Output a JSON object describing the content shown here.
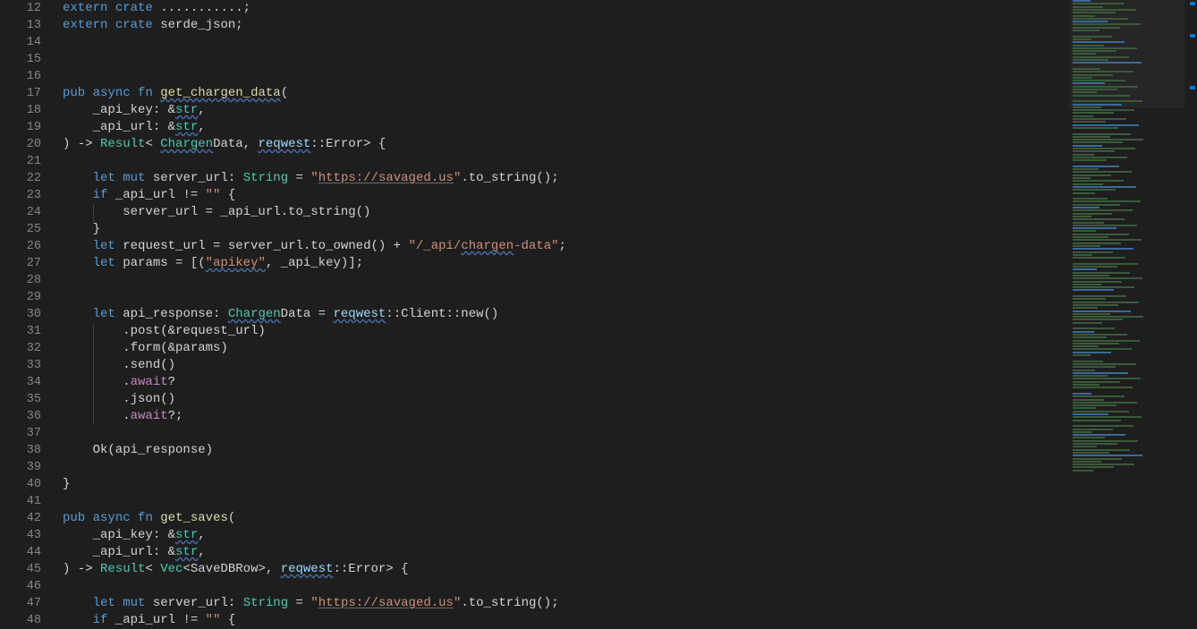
{
  "first_line_number": 12,
  "lines": [
    [
      [
        "kw",
        "extern"
      ],
      [
        "",
        ""
      ],
      [
        "kw",
        "crate"
      ],
      [
        "",
        ""
      ],
      [
        "",
        "...........;"
      ]
    ],
    [
      [
        "kw",
        "extern"
      ],
      [
        "",
        ""
      ],
      [
        "kw",
        "crate"
      ],
      [
        "",
        ""
      ],
      [
        "",
        "serde_json;"
      ]
    ],
    [],
    [],
    [],
    [
      [
        "kw",
        "pub"
      ],
      [
        "",
        ""
      ],
      [
        "kw",
        "async"
      ],
      [
        "",
        ""
      ],
      [
        "kw",
        "fn"
      ],
      [
        "",
        ""
      ],
      [
        "fn squiggly",
        "get_chargen_data"
      ],
      [
        "",
        "("
      ]
    ],
    [
      [
        "",
        "    _api_key: &"
      ],
      [
        "type squiggly",
        "str"
      ],
      [
        "",
        ","
      ]
    ],
    [
      [
        "",
        "    _api_url: &"
      ],
      [
        "type squiggly",
        "str"
      ],
      [
        "",
        ","
      ]
    ],
    [
      [
        "",
        ") -> "
      ],
      [
        "type",
        "Result"
      ],
      [
        "",
        "< "
      ],
      [
        "type squiggly",
        "Chargen"
      ],
      [
        "",
        "Data, "
      ],
      [
        "var squiggly",
        "reqwest"
      ],
      [
        "",
        "::Error> {"
      ]
    ],
    [],
    [
      [
        "",
        "    "
      ],
      [
        "kw",
        "let"
      ],
      [
        "",
        ""
      ],
      [
        "kw",
        "mut"
      ],
      [
        "",
        ""
      ],
      [
        "",
        "server_url: "
      ],
      [
        "type",
        "String"
      ],
      [
        "",
        ""
      ],
      [
        "",
        "="
      ],
      [
        "",
        ""
      ],
      [
        "str",
        "\""
      ],
      [
        "str underline",
        "https://savaged.us"
      ],
      [
        "str",
        "\""
      ],
      [
        "",
        ".to_string();"
      ]
    ],
    [
      [
        "",
        "    "
      ],
      [
        "kw",
        "if"
      ],
      [
        "",
        ""
      ],
      [
        "",
        "_api_url != "
      ],
      [
        "str",
        "\"\""
      ],
      [
        "",
        ""
      ],
      [
        "",
        "{"
      ]
    ],
    [
      [
        "",
        "        server_url = _api_url.to_string()"
      ]
    ],
    [
      [
        "",
        "    }"
      ]
    ],
    [
      [
        "",
        "    "
      ],
      [
        "kw",
        "let"
      ],
      [
        "",
        ""
      ],
      [
        "",
        "request_url = server_url.to_owned() + "
      ],
      [
        "str",
        "\"/_api/"
      ],
      [
        "str squiggly",
        "chargen"
      ],
      [
        "str",
        "-data\""
      ],
      [
        "",
        ";"
      ]
    ],
    [
      [
        "",
        "    "
      ],
      [
        "kw",
        "let"
      ],
      [
        "",
        ""
      ],
      [
        "",
        "params = [("
      ],
      [
        "str squiggly",
        "\"apikey\""
      ],
      [
        "",
        ", _api_key)];"
      ]
    ],
    [],
    [],
    [
      [
        "",
        "    "
      ],
      [
        "kw",
        "let"
      ],
      [
        "",
        ""
      ],
      [
        "",
        "api_response: "
      ],
      [
        "type squiggly",
        "Chargen"
      ],
      [
        "",
        "Data = "
      ],
      [
        "var squiggly",
        "reqwest"
      ],
      [
        "",
        "::Client::new()"
      ]
    ],
    [
      [
        "",
        "        .post(&request_url)"
      ]
    ],
    [
      [
        "",
        "        .form(&params)"
      ]
    ],
    [
      [
        "",
        "        .send()"
      ]
    ],
    [
      [
        "",
        "        ."
      ],
      [
        "kw2",
        "await"
      ],
      [
        "",
        "?"
      ]
    ],
    [
      [
        "",
        "        .json()"
      ]
    ],
    [
      [
        "",
        "        ."
      ],
      [
        "kw2",
        "await"
      ],
      [
        "",
        "?;"
      ]
    ],
    [],
    [
      [
        "",
        "    Ok(api_response)"
      ]
    ],
    [],
    [
      [
        "",
        "}"
      ]
    ],
    [],
    [
      [
        "kw",
        "pub"
      ],
      [
        "",
        ""
      ],
      [
        "kw",
        "async"
      ],
      [
        "",
        ""
      ],
      [
        "kw",
        "fn"
      ],
      [
        "",
        ""
      ],
      [
        "fn",
        "get_saves"
      ],
      [
        "",
        "("
      ]
    ],
    [
      [
        "",
        "    _api_key: &"
      ],
      [
        "type squiggly",
        "str"
      ],
      [
        "",
        ","
      ]
    ],
    [
      [
        "",
        "    _api_url: &"
      ],
      [
        "type squiggly",
        "str"
      ],
      [
        "",
        ","
      ]
    ],
    [
      [
        "",
        ") -> "
      ],
      [
        "type",
        "Result"
      ],
      [
        "",
        "< "
      ],
      [
        "type",
        "Vec"
      ],
      [
        "",
        "<SaveDBRow>, "
      ],
      [
        "var squiggly",
        "reqwest"
      ],
      [
        "",
        "::Error> {"
      ]
    ],
    [],
    [
      [
        "",
        "    "
      ],
      [
        "kw",
        "let"
      ],
      [
        "",
        ""
      ],
      [
        "kw",
        "mut"
      ],
      [
        "",
        ""
      ],
      [
        "",
        "server_url: "
      ],
      [
        "type",
        "String"
      ],
      [
        "",
        ""
      ],
      [
        "",
        "="
      ],
      [
        "",
        ""
      ],
      [
        "str",
        "\""
      ],
      [
        "str underline",
        "https://savaged.us"
      ],
      [
        "str",
        "\""
      ],
      [
        "",
        ".to_string();"
      ]
    ],
    [
      [
        "",
        "    "
      ],
      [
        "kw",
        "if"
      ],
      [
        "",
        ""
      ],
      [
        "",
        "_api_url != "
      ],
      [
        "str",
        "\"\""
      ],
      [
        "",
        ""
      ],
      [
        "",
        "{"
      ]
    ]
  ],
  "minimap_lines": 160,
  "overview_marks": [
    2,
    38,
    96
  ]
}
